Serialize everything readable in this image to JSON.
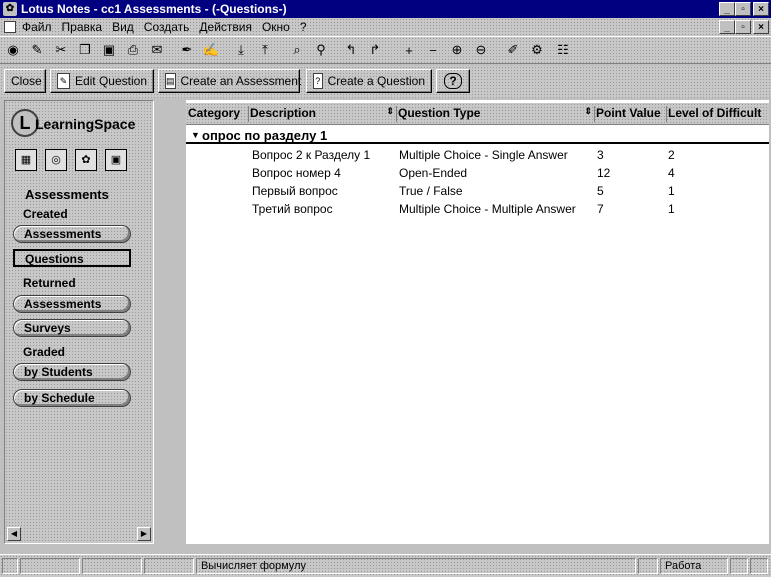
{
  "window": {
    "title": "Lotus Notes - cc1 Assessments - (-Questions-)"
  },
  "window_controls": {
    "minimize": "_",
    "maximize": "▫",
    "close": "×"
  },
  "menubar": {
    "items": [
      "Файл",
      "Правка",
      "Вид",
      "Создать",
      "Действия",
      "Окно",
      "?"
    ]
  },
  "toolbar": {
    "icons": [
      "open-icon",
      "database-icon",
      "cut-icon",
      "copy-icon",
      "paste-icon",
      "print-icon",
      "mail-icon",
      "pen-icon",
      "edit-icon",
      "import-icon",
      "export-icon",
      "search-icon",
      "filter-icon",
      "move-icon",
      "link-icon",
      "expand-icon",
      "collapse-icon",
      "navigate-icon",
      "shrink-icon",
      "tools-icon",
      "properties-icon",
      "view-icon"
    ]
  },
  "actions": {
    "close": "Close",
    "edit_question": "Edit Question",
    "create_assessment": "Create an Assessment",
    "create_question": "Create a Question",
    "help": "?"
  },
  "navigator": {
    "logo": "LearningSpace",
    "heading": "Assessments",
    "created_label": "Created",
    "created_items": [
      "Assessments",
      "Questions"
    ],
    "returned_label": "Returned",
    "returned_items": [
      "Assessments",
      "Surveys"
    ],
    "graded_label": "Graded",
    "graded_items": [
      "by Students",
      "by Schedule"
    ],
    "selected_item": "Questions"
  },
  "view": {
    "columns": [
      "Category",
      "Description",
      "Question Type",
      "Point Value",
      "Level of Difficult"
    ],
    "category": "опрос по разделу 1",
    "rows": [
      {
        "description": "Вопрос 2 к Разделу 1",
        "type": "Multiple Choice - Single Answer",
        "points": "3",
        "level": "2"
      },
      {
        "description": "Вопрос номер 4",
        "type": "Open-Ended",
        "points": "12",
        "level": "4"
      },
      {
        "description": "Первый вопрос",
        "type": "True / False",
        "points": "5",
        "level": "1"
      },
      {
        "description": "Третий вопрос",
        "type": "Multiple Choice - Multiple Answer",
        "points": "7",
        "level": "1"
      }
    ]
  },
  "statusbar": {
    "message": "Вычисляет формулу",
    "state": "Работа"
  }
}
